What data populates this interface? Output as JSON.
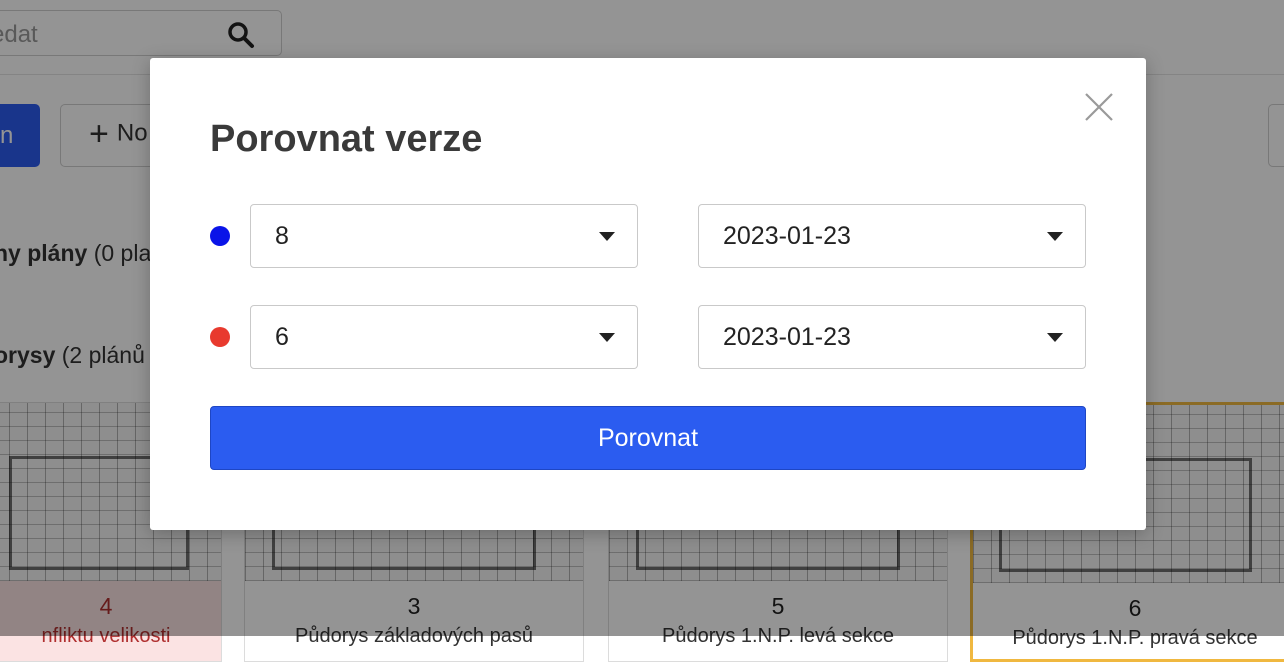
{
  "background": {
    "search": {
      "placeholder_fragment": "edat"
    },
    "primary_button_fragment": "n",
    "new_button_fragment": "No",
    "sections": [
      {
        "title_bold": "ny plány",
        "count": "(0 pla"
      },
      {
        "title_bold": "orysy",
        "count": "(2 plánů"
      }
    ],
    "cards": [
      {
        "number": "4",
        "subtitle": "nfliktu velikosti"
      },
      {
        "number": "3",
        "subtitle": "Půdorys základových pasů"
      },
      {
        "number": "5",
        "subtitle": "Půdorys 1.N.P. levá sekce"
      },
      {
        "number": "6",
        "subtitle": "Půdorys 1.N.P. pravá sekce"
      }
    ]
  },
  "modal": {
    "title": "Porovnat verze",
    "rows": [
      {
        "color": "#0a14e8",
        "version": "8",
        "date": "2023-01-23"
      },
      {
        "color": "#e83a2e",
        "version": "6",
        "date": "2023-01-23"
      }
    ],
    "compare_label": "Porovnat"
  },
  "icons": {
    "search": "search-icon",
    "close": "close-icon",
    "dropdown": "chevron-down-icon",
    "plus": "plus-icon"
  },
  "colors": {
    "accent": "#2b5cf0",
    "version_a": "#0a14e8",
    "version_b": "#e83a2e",
    "conflict_card": "#fbe3e3",
    "selected_card_border": "#f0b840"
  }
}
